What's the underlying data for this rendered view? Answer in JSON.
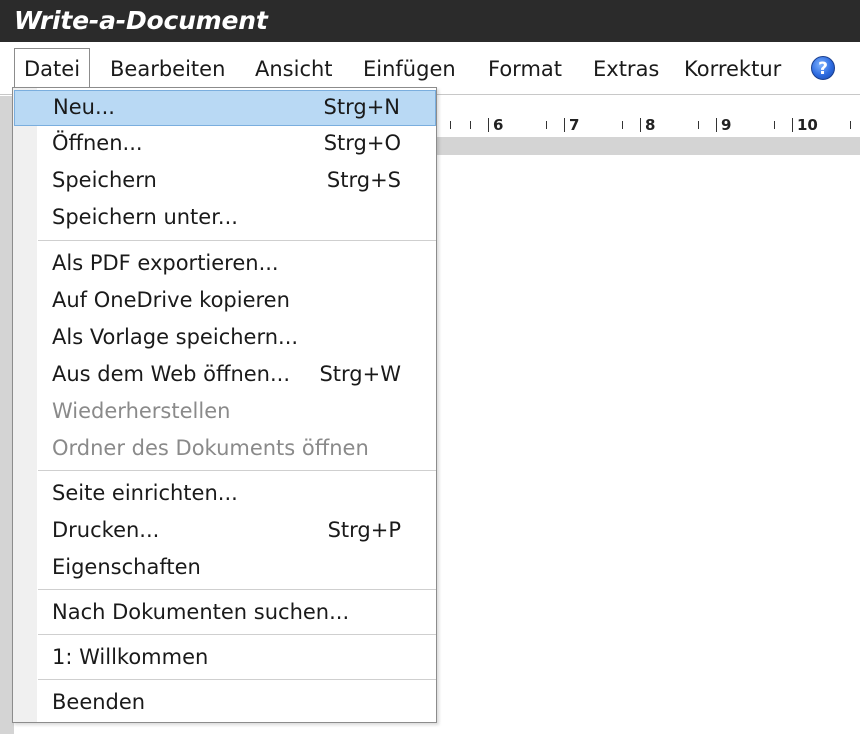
{
  "app": {
    "title": "Write-a-Document"
  },
  "menubar": {
    "items": [
      "Datei",
      "Bearbeiten",
      "Ansicht",
      "Einfügen",
      "Format",
      "Extras",
      "Korrektur"
    ],
    "help_icon": "help-icon"
  },
  "ruler": {
    "numbers": [
      "6",
      "7",
      "8",
      "9",
      "10"
    ]
  },
  "file_menu": {
    "items": [
      {
        "label": "Neu...",
        "shortcut": "Strg+N"
      },
      {
        "label": "Öffnen...",
        "shortcut": "Strg+O"
      },
      {
        "label": "Speichern",
        "shortcut": "Strg+S"
      },
      {
        "label": "Speichern unter...",
        "shortcut": ""
      },
      {
        "label": "Als PDF exportieren...",
        "shortcut": ""
      },
      {
        "label": "Auf OneDrive kopieren",
        "shortcut": ""
      },
      {
        "label": "Als Vorlage speichern...",
        "shortcut": ""
      },
      {
        "label": "Aus dem Web öffnen...",
        "shortcut": "Strg+W"
      },
      {
        "label": "Wiederherstellen",
        "shortcut": ""
      },
      {
        "label": "Ordner des Dokuments öffnen",
        "shortcut": ""
      },
      {
        "label": "Seite einrichten...",
        "shortcut": ""
      },
      {
        "label": "Drucken...",
        "shortcut": "Strg+P"
      },
      {
        "label": "Eigenschaften",
        "shortcut": ""
      },
      {
        "label": "Nach Dokumenten suchen...",
        "shortcut": ""
      },
      {
        "label": "1: Willkommen",
        "shortcut": ""
      },
      {
        "label": "Beenden",
        "shortcut": ""
      }
    ]
  },
  "colors": {
    "titlebar": "#2b2b2b",
    "highlight": "#b9d9f4",
    "disabled_text": "#8a8a8a"
  }
}
